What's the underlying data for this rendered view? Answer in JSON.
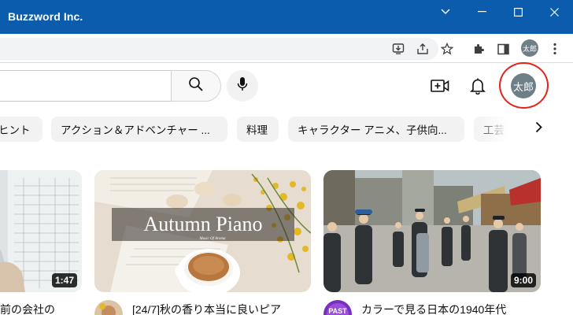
{
  "window": {
    "title": "Buzzword Inc.",
    "controls": [
      "chevron-down-icon",
      "minimize-icon",
      "maximize-icon",
      "close-icon"
    ]
  },
  "browser": {
    "profile_initials": "太郎",
    "toolbar_icons": [
      "install-icon",
      "share-icon",
      "bookmark-star-icon",
      "extensions-icon",
      "side-panel-icon",
      "menu-kebab-icon"
    ]
  },
  "header": {
    "search_placeholder": "",
    "avatar_initials": "太郎",
    "icons": [
      "search-icon",
      "mic-icon",
      "create-video-icon",
      "notifications-bell-icon"
    ],
    "highlight_color": "#e4231b"
  },
  "chips": [
    {
      "label": "ヒント"
    },
    {
      "label": "アクション＆アドベンチャー ..."
    },
    {
      "label": "料理"
    },
    {
      "label": "キャラクター アニメ、子供向..."
    },
    {
      "label": "工芸"
    }
  ],
  "videos": [
    {
      "title": "前の会社の",
      "duration": "1:47"
    },
    {
      "title": "[24/7]秋の香り本当に良いピア",
      "thumb_text": "Autumn Piano",
      "thumb_subtext": "Music Of Aroma",
      "duration": ""
    },
    {
      "title": "カラーで見る日本の1940年代",
      "duration": "9:00",
      "channel_badge": "PAST"
    }
  ]
}
